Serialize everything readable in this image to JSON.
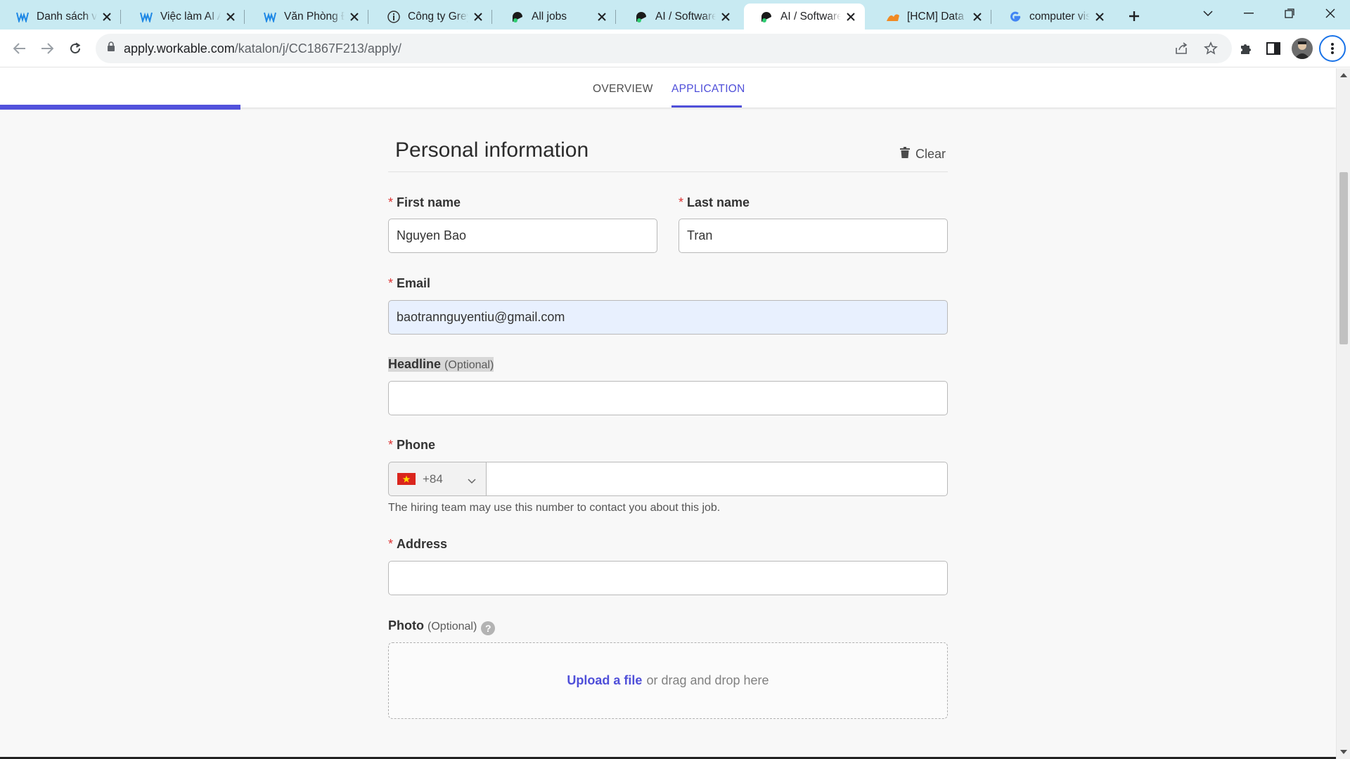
{
  "browser": {
    "tabs": [
      {
        "title": "Danh sách việc làm",
        "icon": "workable-w-icon"
      },
      {
        "title": "Việc làm AI Analyst",
        "icon": "workable-w-icon"
      },
      {
        "title": "Văn Phòng Đại Diện",
        "icon": "workable-w-icon"
      },
      {
        "title": "Công ty Greystone",
        "icon": "info-icon"
      },
      {
        "title": "All jobs",
        "icon": "katalon-icon"
      },
      {
        "title": "AI / Software Engineer",
        "icon": "katalon-icon"
      },
      {
        "title": "AI / Software Engineer",
        "icon": "katalon-icon",
        "active": true
      },
      {
        "title": "[HCM] Data Scientist",
        "icon": "flame-icon"
      },
      {
        "title": "computer vision",
        "icon": "google-icon"
      }
    ],
    "url_host": "apply.workable.com",
    "url_path": "/katalon/j/CC1867F213/apply/"
  },
  "subnav": {
    "overview_label": "OVERVIEW",
    "application_label": "APPLICATION",
    "progress_fraction": 0.18
  },
  "form": {
    "section_title": "Personal information",
    "clear_label": "Clear",
    "required_mark": "*",
    "first_name": {
      "label": "First name",
      "value": "Nguyen Bao"
    },
    "last_name": {
      "label": "Last name",
      "value": "Tran"
    },
    "email": {
      "label": "Email",
      "value": "baotrannguyentiu@gmail.com"
    },
    "headline": {
      "label": "Headline",
      "optional": "(Optional)",
      "value": ""
    },
    "phone": {
      "label": "Phone",
      "country_code": "+84",
      "country_flag": "vietnam-flag-icon",
      "value": "",
      "hint": "The hiring team may use this number to contact you about this job."
    },
    "address": {
      "label": "Address",
      "value": ""
    },
    "photo": {
      "label": "Photo",
      "optional": "(Optional)",
      "help": "?",
      "upload_link": "Upload a file",
      "upload_rest": "or drag and drop here"
    }
  },
  "colors": {
    "accent": "#4f4fd9",
    "required": "#dd3333",
    "tabstrip": "#c8eaf2"
  }
}
